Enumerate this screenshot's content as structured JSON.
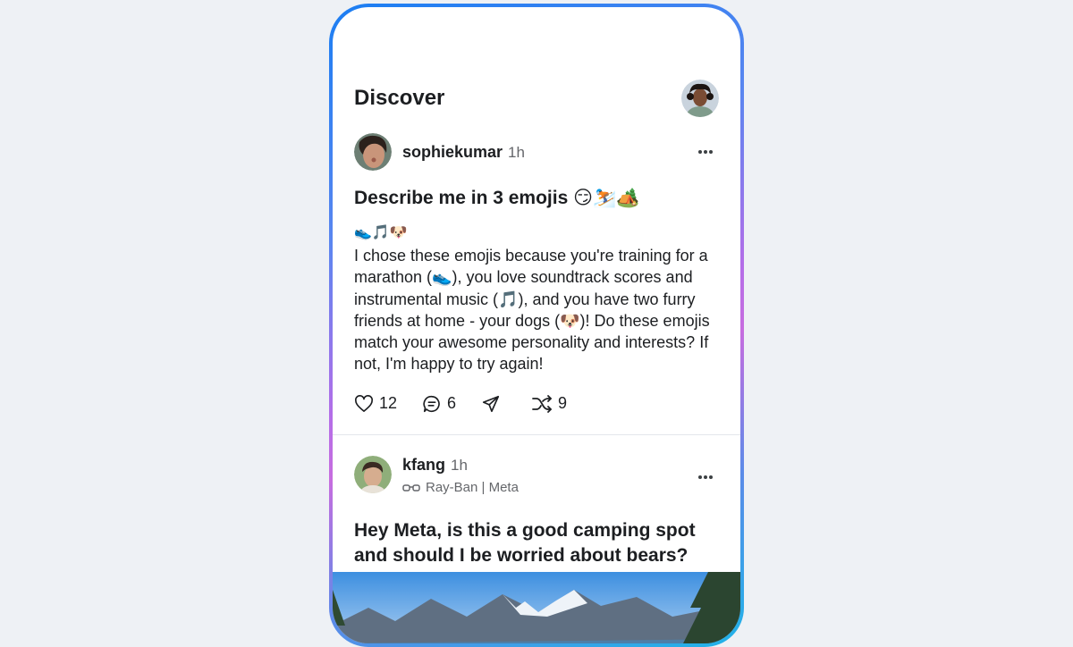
{
  "header": {
    "title": "Discover"
  },
  "post1": {
    "username": "sophiekumar",
    "time": "1h",
    "prompt": "Describe me in 3 emojis 😏⛷️🏕️",
    "emoji_line": "👟🎵🐶",
    "body": "I chose these emojis because you're training for a marathon (👟), you love soundtrack scores and instrumental music (🎵), and you have two furry friends at home - your dogs (🐶)! Do these emojis match your awesome personality and interests? If not, I'm happy to try again!",
    "likes": "12",
    "comments": "6",
    "shares": "9"
  },
  "post2": {
    "username": "kfang",
    "time": "1h",
    "device": "Ray-Ban | Meta",
    "prompt": "Hey Meta, is this a good camping spot and should I be worried about bears?"
  },
  "icons": {
    "more": "more-horizontal-icon",
    "like": "heart-icon",
    "comment": "comment-icon",
    "share": "send-icon",
    "remix": "shuffle-icon",
    "glasses": "glasses-icon"
  },
  "colors": {
    "text": "#1c1e21",
    "muted": "#65676b",
    "frame_start": "#1b7ef2",
    "frame_mid": "#c76ddf",
    "frame_end": "#1fb3e8"
  }
}
